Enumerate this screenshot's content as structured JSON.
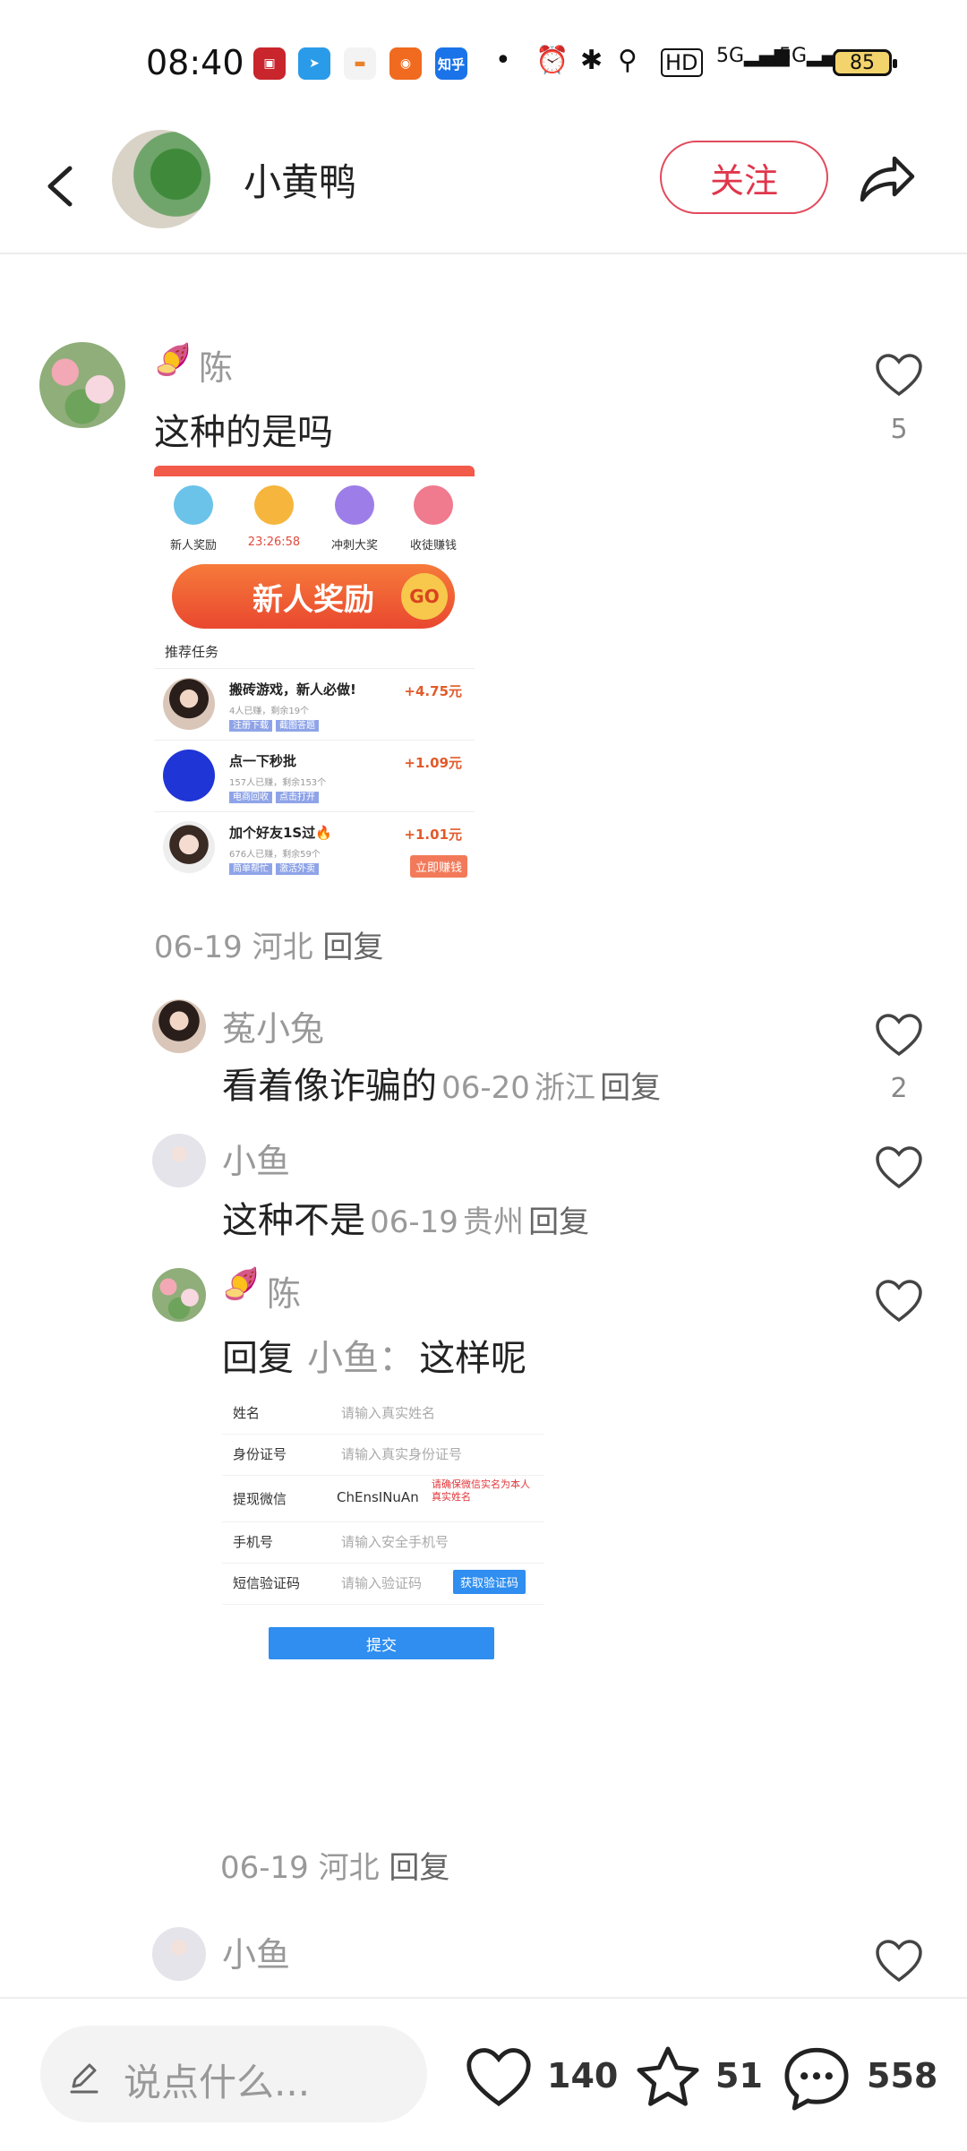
{
  "status_bar": {
    "time": "08:40",
    "zhihu": "知乎",
    "network": "5G",
    "battery": "85"
  },
  "header": {
    "username": "小黄鸭",
    "follow_label": "关注"
  },
  "comments": [
    {
      "name": "陈",
      "text": "这种的是吗",
      "likes": "5",
      "date": "06-19",
      "location": "河北",
      "reply": "回复",
      "screenshot": {
        "icons": [
          "新人奖励",
          "23:26:58",
          "冲刺大奖",
          "收徒赚钱"
        ],
        "banner": "新人奖励",
        "banner_go": "GO",
        "section": "推荐任务",
        "tasks": [
          {
            "title": "搬砖游戏，新人必做!",
            "sub": "4人已赚，剩余19个",
            "tags": [
              "注册下载",
              "截图答题"
            ],
            "reward": "+4.75元"
          },
          {
            "title": "点一下秒批",
            "sub": "157人已赚，剩余153个",
            "tags": [
              "电商回收",
              "点击打开"
            ],
            "reward": "+1.09元"
          },
          {
            "title": "加个好友1S过🔥",
            "sub": "676人已赚，剩余59个",
            "tags": [
              "简单帮忙",
              "激活外卖"
            ],
            "reward": "+1.01元",
            "button": "立即赚钱"
          }
        ]
      }
    }
  ],
  "replies": [
    {
      "name": "菟小兔",
      "text": "看着像诈骗的",
      "date": "06-20",
      "location": "浙江",
      "reply": "回复",
      "likes": "2"
    },
    {
      "name": "小鱼",
      "text": "这种不是",
      "date": "06-19",
      "location": "贵州",
      "reply": "回复"
    },
    {
      "name": "陈",
      "reply_prefix": "回复",
      "reply_to": "小鱼",
      "reply_colon": "：",
      "text": "这样呢",
      "date": "06-19",
      "location": "河北",
      "reply": "回复",
      "form": {
        "rows": [
          {
            "label": "姓名",
            "placeholder": "请输入真实姓名"
          },
          {
            "label": "身份证号",
            "placeholder": "请输入真实身份证号"
          },
          {
            "label": "提现微信",
            "value": "ChEnsINuAn",
            "note": "请确保微信实名为本人真实姓名"
          },
          {
            "label": "手机号",
            "placeholder": "请输入安全手机号"
          },
          {
            "label": "短信验证码",
            "placeholder": "请输入验证码",
            "button": "获取验证码"
          }
        ],
        "submit": "提交"
      }
    },
    {
      "name": "小鱼"
    }
  ],
  "bottom_bar": {
    "placeholder": "说点什么...",
    "likes": "140",
    "stars": "51",
    "comments": "558"
  },
  "colors": {
    "accent_red": "#e0364b",
    "button_blue": "#2f8ef0"
  }
}
